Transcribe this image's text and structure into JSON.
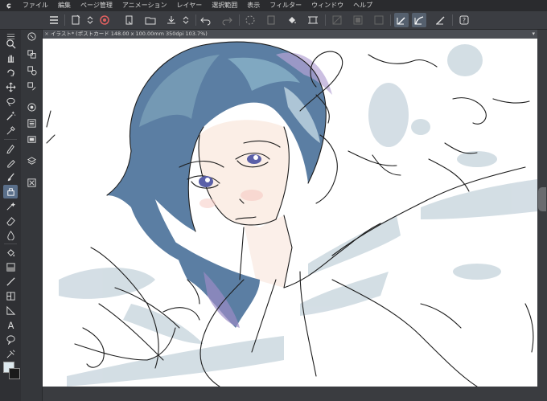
{
  "menubar": {
    "logo_glyph": "ɕ",
    "items": [
      "ファイル",
      "編集",
      "ページ管理",
      "アニメーション",
      "レイヤー",
      "選択範囲",
      "表示",
      "フィルター",
      "ウィンドウ",
      "ヘルプ"
    ]
  },
  "commandbar": {
    "icons": [
      "menu-icon",
      "new-file-icon",
      "stepper-icon",
      "cloud-icon",
      "open-folder-icon",
      "save-icon",
      "stepper-icon",
      "undo-icon",
      "redo-icon",
      "loading-icon",
      "clear-icon",
      "fill-icon",
      "transform-icon",
      "deselect-icon",
      "invert-icon",
      "expand-icon",
      "snap-ruler-icon",
      "snap-curve-icon",
      "snap-special-icon",
      "grid-icon",
      "help-icon"
    ]
  },
  "canvas_tab": {
    "close_glyph": "×",
    "label": "イラスト* (ポストカード 148.00 x 100.00mm 350dpi 103.7%)",
    "arrow_glyph": "▾"
  },
  "left_tools": [
    "zoom-icon",
    "hand-icon",
    "rotate-icon",
    "move-icon",
    "lasso-icon",
    "wand-icon",
    "eyedropper-icon",
    "pen-icon",
    "pencil-icon",
    "brush-icon",
    "airbrush-icon",
    "decoration-icon",
    "eraser-icon",
    "blend-icon",
    "fill-icon",
    "gradient-icon",
    "figure-icon",
    "frame-icon",
    "ruler-icon",
    "text-icon",
    "balloon-icon",
    "line-fix-icon"
  ],
  "colors": {
    "main": "#dde8ee",
    "sub": "#1a1a1a",
    "accent": "#5a6f8a",
    "hair": "#5b7ea3"
  }
}
